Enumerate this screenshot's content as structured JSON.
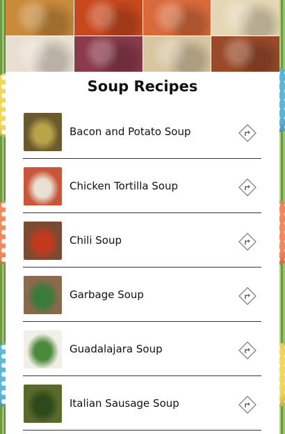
{
  "header": {
    "title": "Soup Recipes",
    "collage_tiles": [
      {
        "icon": "fried-balls-photo",
        "color": "#c98a3a"
      },
      {
        "icon": "curry-photo",
        "color": "#c8481e"
      },
      {
        "icon": "shrimp-photo",
        "color": "#d86a3c"
      },
      {
        "icon": "noodle-dish-photo",
        "color": "#e5d7b5"
      },
      {
        "icon": "tofu-photo",
        "color": "#e8dfd1"
      },
      {
        "icon": "fruit-tart-photo",
        "color": "#8a3a4a"
      },
      {
        "icon": "sesame-balls-photo",
        "color": "#d8c6a2"
      },
      {
        "icon": "rice-dish-photo",
        "color": "#9a4a2a"
      }
    ]
  },
  "recipes": [
    {
      "name": "Bacon and Potato Soup",
      "thumb_color": "#6b5a2e",
      "thumb_accent": "#b8a24a"
    },
    {
      "name": "Chicken Tortilla Soup",
      "thumb_color": "#c9553a",
      "thumb_accent": "#e8e0d0"
    },
    {
      "name": "Chili Soup",
      "thumb_color": "#7a4a32",
      "thumb_accent": "#c23a1e"
    },
    {
      "name": "Garbage Soup",
      "thumb_color": "#8a6a4a",
      "thumb_accent": "#3a7a3a"
    },
    {
      "name": "Guadalajara Soup",
      "thumb_color": "#f2efe8",
      "thumb_accent": "#4a8a3a"
    },
    {
      "name": "Italian Sausage Soup",
      "thumb_color": "#5a6a2a",
      "thumb_accent": "#2e4a1a"
    }
  ],
  "row_icon": "share-arrow-icon"
}
